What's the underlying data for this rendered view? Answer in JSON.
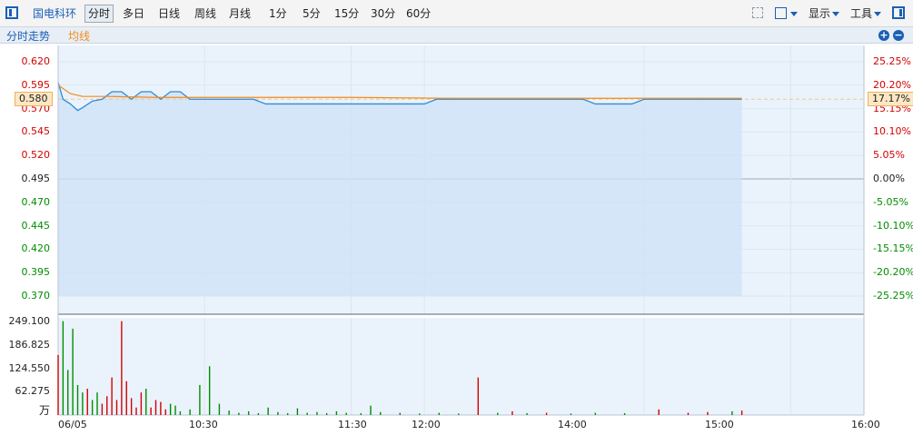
{
  "toolbar": {
    "stock_name": "国电科环",
    "periods": [
      {
        "label": "分时",
        "active": true
      },
      {
        "label": "多日",
        "active": false
      },
      {
        "label": "日线",
        "active": false
      },
      {
        "label": "周线",
        "active": false
      },
      {
        "label": "月线",
        "active": false
      },
      {
        "label": "1分",
        "active": false
      },
      {
        "label": "5分",
        "active": false
      },
      {
        "label": "15分",
        "active": false
      },
      {
        "label": "30分",
        "active": false
      },
      {
        "label": "60分",
        "active": false
      }
    ],
    "display_label": "显示",
    "tools_label": "工具"
  },
  "chart_header": {
    "title": "分时走势",
    "avg_label": "均线"
  },
  "current": {
    "price_tag": "0.580",
    "pct_tag": "17.17%"
  },
  "colors": {
    "up": "#d40000",
    "down": "#008c00",
    "price_line": "#2f8bd8",
    "avg_line": "#f08c1e",
    "area_fill": "#cfe2f8",
    "grid": "#dce6f0"
  },
  "chart_data": [
    {
      "type": "line",
      "name": "price",
      "base_price": 0.495,
      "ylim": [
        0.37,
        0.62
      ],
      "y_ticks_left": [
        "0.620",
        "0.595",
        "0.570",
        "0.545",
        "0.520",
        "0.495",
        "0.470",
        "0.445",
        "0.420",
        "0.395",
        "0.370"
      ],
      "y_ticks_right": [
        "25.25%",
        "20.20%",
        "15.15%",
        "10.10%",
        "5.05%",
        "0.00%",
        "-5.05%",
        "-10.10%",
        "-15.15%",
        "-20.20%",
        "-25.25%"
      ],
      "x_ticks": [
        "06/05",
        "10:30",
        "11:30",
        "12:00",
        "14:00",
        "15:00",
        "16:00"
      ],
      "series": [
        {
          "name": "price",
          "points": [
            [
              0,
              0.598
            ],
            [
              2,
              0.58
            ],
            [
              5,
              0.575
            ],
            [
              8,
              0.568
            ],
            [
              10,
              0.571
            ],
            [
              14,
              0.578
            ],
            [
              18,
              0.58
            ],
            [
              22,
              0.588
            ],
            [
              26,
              0.588
            ],
            [
              30,
              0.58
            ],
            [
              34,
              0.588
            ],
            [
              38,
              0.588
            ],
            [
              42,
              0.58
            ],
            [
              46,
              0.588
            ],
            [
              50,
              0.588
            ],
            [
              54,
              0.58
            ],
            [
              60,
              0.58
            ],
            [
              80,
              0.58
            ],
            [
              85,
              0.575
            ],
            [
              120,
              0.575
            ],
            [
              150,
              0.575
            ],
            [
              155,
              0.58
            ],
            [
              215,
              0.58
            ],
            [
              220,
              0.575
            ],
            [
              235,
              0.575
            ],
            [
              240,
              0.58
            ],
            [
              280,
              0.58
            ]
          ]
        },
        {
          "name": "avg",
          "points": [
            [
              0,
              0.595
            ],
            [
              5,
              0.586
            ],
            [
              10,
              0.583
            ],
            [
              20,
              0.583
            ],
            [
              40,
              0.582
            ],
            [
              80,
              0.582
            ],
            [
              120,
              0.582
            ],
            [
              160,
              0.581
            ],
            [
              220,
              0.581
            ],
            [
              280,
              0.581
            ]
          ]
        }
      ]
    },
    {
      "type": "bar",
      "name": "volume",
      "unit": "万",
      "ylim": [
        0,
        249.1
      ],
      "y_ticks": [
        "249.100",
        "186.825",
        "124.550",
        "62.275"
      ],
      "bars": [
        [
          0,
          160,
          "up"
        ],
        [
          2,
          250,
          "down"
        ],
        [
          4,
          120,
          "down"
        ],
        [
          6,
          230,
          "down"
        ],
        [
          8,
          80,
          "down"
        ],
        [
          10,
          60,
          "down"
        ],
        [
          12,
          70,
          "up"
        ],
        [
          14,
          40,
          "down"
        ],
        [
          16,
          60,
          "down"
        ],
        [
          18,
          30,
          "up"
        ],
        [
          20,
          50,
          "up"
        ],
        [
          22,
          100,
          "up"
        ],
        [
          24,
          40,
          "up"
        ],
        [
          26,
          250,
          "up"
        ],
        [
          28,
          90,
          "up"
        ],
        [
          30,
          45,
          "up"
        ],
        [
          32,
          20,
          "up"
        ],
        [
          34,
          60,
          "up"
        ],
        [
          36,
          70,
          "down"
        ],
        [
          38,
          20,
          "up"
        ],
        [
          40,
          40,
          "up"
        ],
        [
          42,
          35,
          "up"
        ],
        [
          44,
          15,
          "up"
        ],
        [
          46,
          30,
          "down"
        ],
        [
          48,
          25,
          "down"
        ],
        [
          50,
          10,
          "down"
        ],
        [
          54,
          15,
          "down"
        ],
        [
          58,
          80,
          "down"
        ],
        [
          62,
          130,
          "down"
        ],
        [
          66,
          30,
          "down"
        ],
        [
          70,
          12,
          "down"
        ],
        [
          74,
          6,
          "down"
        ],
        [
          78,
          10,
          "down"
        ],
        [
          82,
          5,
          "down"
        ],
        [
          86,
          20,
          "down"
        ],
        [
          90,
          8,
          "down"
        ],
        [
          94,
          5,
          "down"
        ],
        [
          98,
          18,
          "down"
        ],
        [
          102,
          6,
          "down"
        ],
        [
          106,
          8,
          "down"
        ],
        [
          110,
          5,
          "down"
        ],
        [
          114,
          10,
          "down"
        ],
        [
          118,
          6,
          "down"
        ],
        [
          124,
          5,
          "down"
        ],
        [
          128,
          25,
          "down"
        ],
        [
          132,
          8,
          "down"
        ],
        [
          140,
          6,
          "down"
        ],
        [
          148,
          4,
          "down"
        ],
        [
          156,
          6,
          "down"
        ],
        [
          164,
          4,
          "down"
        ],
        [
          172,
          100,
          "up"
        ],
        [
          180,
          6,
          "down"
        ],
        [
          186,
          10,
          "up"
        ],
        [
          192,
          5,
          "down"
        ],
        [
          200,
          6,
          "up"
        ],
        [
          210,
          4,
          "down"
        ],
        [
          220,
          6,
          "down"
        ],
        [
          232,
          5,
          "down"
        ],
        [
          246,
          15,
          "up"
        ],
        [
          258,
          6,
          "up"
        ],
        [
          266,
          8,
          "up"
        ],
        [
          276,
          10,
          "down"
        ],
        [
          280,
          12,
          "up"
        ]
      ]
    }
  ]
}
